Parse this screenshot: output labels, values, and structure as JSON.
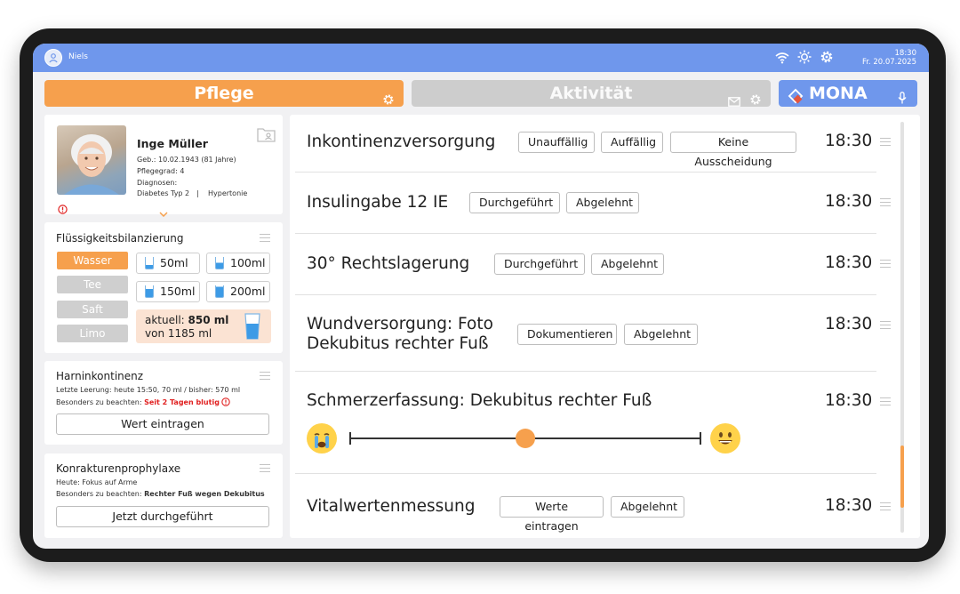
{
  "status": {
    "user": "Niels",
    "time": "18:30",
    "date": "Fr. 20.07.2025"
  },
  "tabs": {
    "pflege": "Pflege",
    "aktivitaet": "Aktivität",
    "mona": "MONA"
  },
  "patient": {
    "name": "Inge Müller",
    "birth": "Geb.: 10.02.1943 (81 Jahre)",
    "care_level": "Pflegegrad: 4",
    "diagnoses_label": "Diagnosen:",
    "diagnosis_1": "Diabetes Typ 2",
    "separator": "|",
    "diagnosis_2": "Hypertonie"
  },
  "fluid": {
    "title": "Flüssigkeitsbilanzierung",
    "drinks": [
      "Wasser",
      "Tee",
      "Saft",
      "Limo"
    ],
    "amounts": [
      "50ml",
      "100ml",
      "150ml",
      "200ml"
    ],
    "current_label": "aktuell:",
    "current_value": "850 ml",
    "total": "von 1185 ml"
  },
  "harn": {
    "title": "Harninkontinenz",
    "last": "Letzte Leerung: heute 15:50, 70 ml / bisher: 570 ml",
    "note_label": "Besonders zu beachten:",
    "note_value": "Seit 2 Tagen blutig",
    "button": "Wert eintragen"
  },
  "kontraktur": {
    "title": "Konrakturenprophylaxe",
    "today": "Heute: Fokus auf Arme",
    "note_label": "Besonders zu beachten:",
    "note_value": "Rechter Fuß wegen Dekubitus",
    "button": "Jetzt durchgeführt"
  },
  "tasks": [
    {
      "title": "Inkontinenzversorgung",
      "time": "18:30",
      "buttons": [
        "Unauffällig",
        "Auffällig",
        "Keine Ausscheidung"
      ]
    },
    {
      "title": "Insulingabe 12 IE",
      "time": "18:30",
      "buttons": [
        "Durchgeführt",
        "Abgelehnt"
      ]
    },
    {
      "title": "30° Rechtslagerung",
      "time": "18:30",
      "buttons": [
        "Durchgeführt",
        "Abgelehnt"
      ]
    },
    {
      "title_line1": "Wundversorgung: Foto",
      "title_line2": "Dekubitus rechter Fuß",
      "time": "18:30",
      "buttons": [
        "Dokumentieren",
        "Abgelehnt"
      ]
    },
    {
      "title": "Schmerzerfassung: Dekubitus rechter Fuß",
      "time": "18:30",
      "pain_level": 0.5
    },
    {
      "title": "Vitalwertenmessung",
      "time": "18:30",
      "buttons": [
        "Werte eintragen",
        "Abgelehnt"
      ]
    }
  ],
  "colors": {
    "accent": "#f6a04d",
    "primary": "#6f97ec",
    "alert": "#e02020",
    "inactive": "#cdcdcd"
  }
}
